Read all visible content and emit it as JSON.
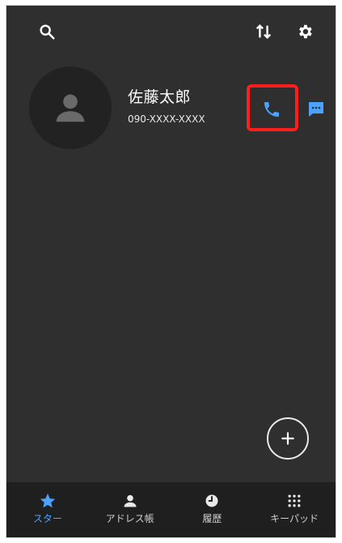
{
  "contact": {
    "name": "佐藤太郎",
    "number": "090-XXXX-XXXX"
  },
  "bottom_nav": {
    "items": [
      {
        "label": "スター",
        "icon": "star-icon",
        "active": true
      },
      {
        "label": "アドレス帳",
        "icon": "person-icon",
        "active": false
      },
      {
        "label": "履歴",
        "icon": "clock-icon",
        "active": false
      },
      {
        "label": "キーパッド",
        "icon": "keypad-icon",
        "active": false
      }
    ]
  },
  "colors": {
    "background": "#2f2f2f",
    "accent": "#4aa3ff",
    "highlight": "#ff1d1d",
    "nav_bg": "#1f1f1f"
  },
  "icons": {
    "top_left": "search-icon",
    "top_right_1": "sort-icon",
    "top_right_2": "gear-icon",
    "call": "phone-icon",
    "message": "message-icon",
    "fab": "plus-icon"
  }
}
